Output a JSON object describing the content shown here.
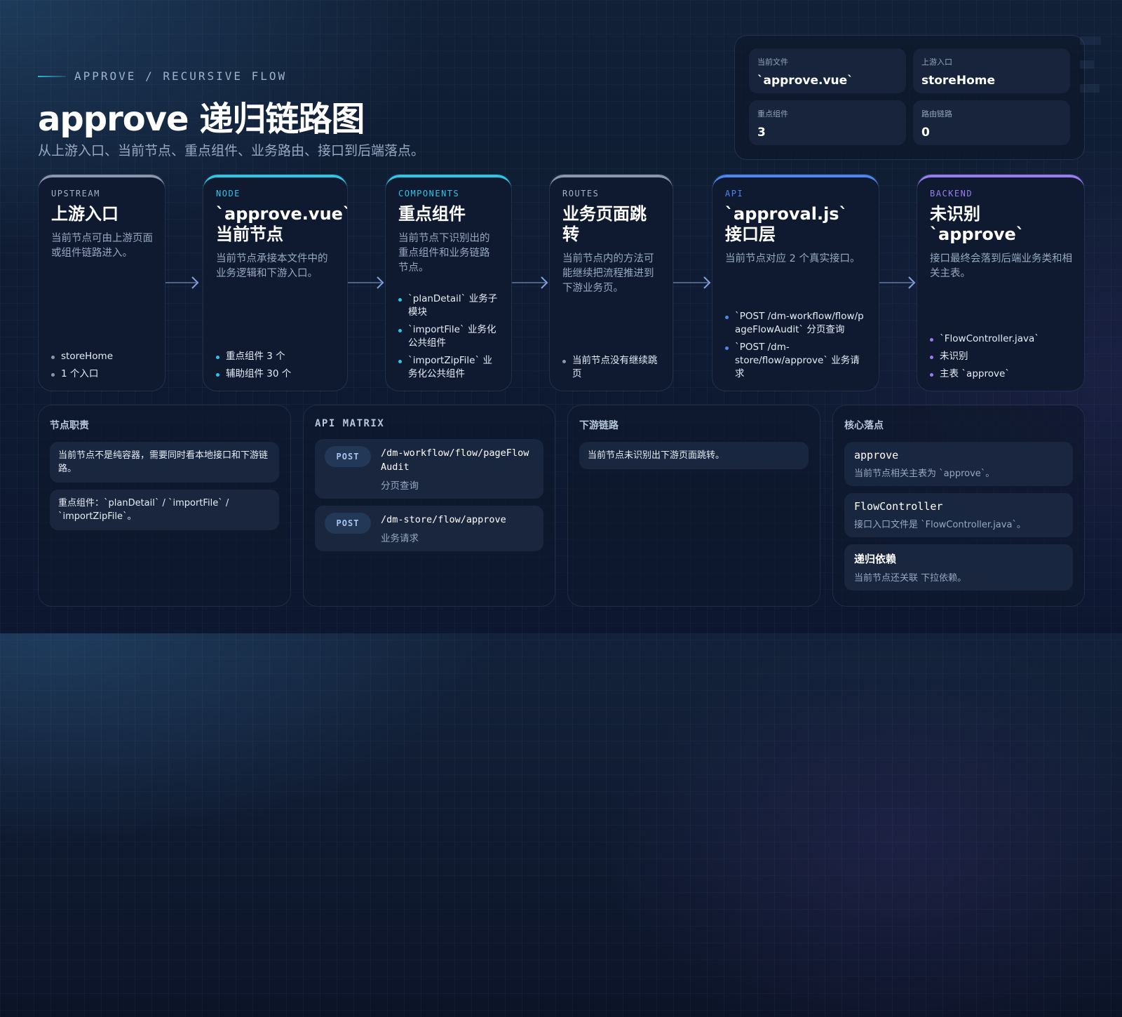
{
  "header": {
    "eyebrow": "APPROVE / RECURSIVE FLOW",
    "title": "approve 递归链路图",
    "subtitle": "从上游入口、当前节点、重点组件、业务路由、接口到后端落点。"
  },
  "stats": [
    {
      "label": "当前文件",
      "value": "`approve.vue`"
    },
    {
      "label": "上游入口",
      "value": "storeHome"
    },
    {
      "label": "重点组件",
      "value": "3"
    },
    {
      "label": "路由链路",
      "value": "0"
    }
  ],
  "flow": [
    {
      "kicker": "UPSTREAM",
      "title": "上游入口",
      "desc": "当前节点可由上游页面或组件链路进入。",
      "accent": "#8a96ab",
      "items": [
        "storeHome",
        "1 个入口"
      ]
    },
    {
      "kicker": "NODE",
      "title": "`approve.vue` 当前节点",
      "desc": "当前节点承接本文件中的业务逻辑和下游入口。",
      "accent": "#2fc6e6",
      "items": [
        "重点组件 3 个",
        "辅助组件 30 个"
      ]
    },
    {
      "kicker": "COMPONENTS",
      "title": "重点组件",
      "desc": "当前节点下识别出的重点组件和业务链路节点。",
      "accent": "#2fc6e6",
      "items": [
        "`planDetail` 业务子模块",
        "`importFile` 业务化公共组件",
        "`importZipFile` 业务化公共组件"
      ]
    },
    {
      "kicker": "ROUTES",
      "title": "业务页面跳转",
      "desc": "当前节点内的方法可能继续把流程推进到下游业务页。",
      "accent": "#8a96ab",
      "items": [
        "当前节点没有继续跳页"
      ]
    },
    {
      "kicker": "API",
      "title": "`approval.js` 接口层",
      "desc": "当前节点对应 2 个真实接口。",
      "accent": "#4d86f0",
      "items": [
        "`POST /dm-workflow/flow/pageFlowAudit` 分页查询",
        "`POST /dm-store/flow/approve` 业务请求"
      ]
    },
    {
      "kicker": "BACKEND",
      "title": "未识别 `approve`",
      "desc": "接口最终会落到后端业务类和相关主表。",
      "accent": "#9b7cf0",
      "items": [
        "`FlowController.java`",
        "未识别",
        "主表 `approve`"
      ]
    }
  ],
  "panels": {
    "duty": {
      "title": "节点职责",
      "notes": [
        "当前节点不是纯容器，需要同时看本地接口和下游链路。",
        "重点组件：`planDetail` / `importFile` / `importZipFile`。"
      ]
    },
    "api": {
      "title": "API MATRIX",
      "rows": [
        {
          "method": "POST",
          "path": "/dm-workflow/flow/pageFlowAudit",
          "desc": "分页查询"
        },
        {
          "method": "POST",
          "path": "/dm-store/flow/approve",
          "desc": "业务请求"
        }
      ]
    },
    "downstream": {
      "title": "下游链路",
      "notes": [
        "当前节点未识别出下游页面跳转。"
      ]
    },
    "core": {
      "title": "核心落点",
      "items": [
        {
          "name": "approve",
          "desc": "当前节点相关主表为 `approve`。"
        },
        {
          "name": "FlowController",
          "desc": "接口入口文件是 `FlowController.java`。"
        },
        {
          "name": "递归依赖",
          "desc": "当前节点还关联 下拉依赖。"
        }
      ]
    }
  },
  "colors": {
    "muted": "#8a96ab",
    "cyan": "#2fc6e6",
    "blue": "#4d86f0",
    "violet": "#9b7cf0"
  }
}
